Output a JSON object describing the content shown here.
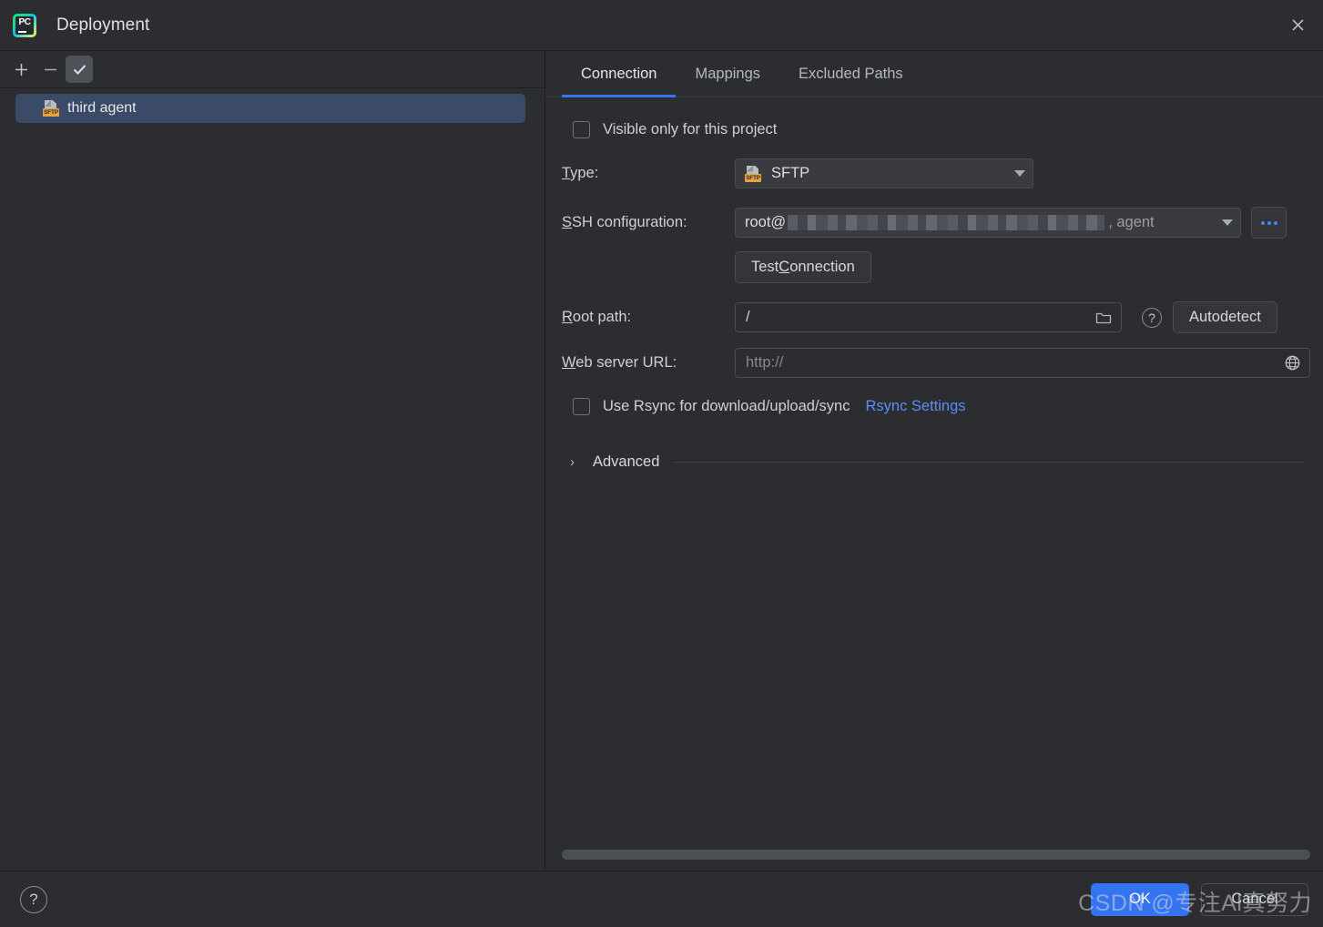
{
  "window": {
    "title": "Deployment",
    "app_icon": "pycharm-logo",
    "app_icon_text": "PC",
    "close_icon": "close-icon"
  },
  "left_panel": {
    "toolbar": {
      "add_icon": "plus-icon",
      "remove_icon": "minus-icon",
      "set_default_icon": "checkmark-icon"
    },
    "items": [
      {
        "label": "third agent",
        "icon": "sftp-server-icon",
        "badge": "SFTP",
        "selected": true
      }
    ]
  },
  "tabs": [
    {
      "label": "Connection",
      "active": true
    },
    {
      "label": "Mappings",
      "active": false
    },
    {
      "label": "Excluded Paths",
      "active": false
    }
  ],
  "form": {
    "visible_only": {
      "label": "Visible only for this project",
      "checked": false
    },
    "type": {
      "label_prefix": "T",
      "label_rest": "ype:",
      "value": "SFTP",
      "badge": "SFTP",
      "icon": "sftp-server-icon",
      "caret_icon": "chevron-down-icon"
    },
    "ssh_configuration": {
      "label_prefix": "S",
      "label_rest": "SH configuration:",
      "value_prefix": "root@",
      "value_redacted": true,
      "value_suffix": ", agent",
      "caret_icon": "chevron-down-icon",
      "browse_label": "...",
      "browse_icon": "ellipsis-icon"
    },
    "test_connection": {
      "label_before": "Test ",
      "label_mnemonic": "C",
      "label_after": "onnection"
    },
    "root_path": {
      "label_prefix": "R",
      "label_rest": "oot path:",
      "value": "/",
      "browse_icon": "folder-icon",
      "help_icon": "question-mark-icon",
      "autodetect_label": "Autodetect"
    },
    "web_server_url": {
      "label_prefix": "W",
      "label_rest": "eb server URL:",
      "value": "http://",
      "is_placeholder": true,
      "globe_icon": "globe-icon"
    },
    "rsync": {
      "checkbox_label": "Use Rsync for download/upload/sync",
      "checked": false,
      "settings_link": "Rsync Settings",
      "link_color": "#5b8ef5"
    },
    "advanced": {
      "label": "Advanced",
      "expanded": false,
      "caret_icon": "chevron-right-icon"
    }
  },
  "footer": {
    "help_icon": "question-mark-icon",
    "ok_label": "OK",
    "cancel_label": "Cancel",
    "ok_color": "#3574f0"
  },
  "watermark": {
    "text": "CSDN @专注Al真努力"
  }
}
